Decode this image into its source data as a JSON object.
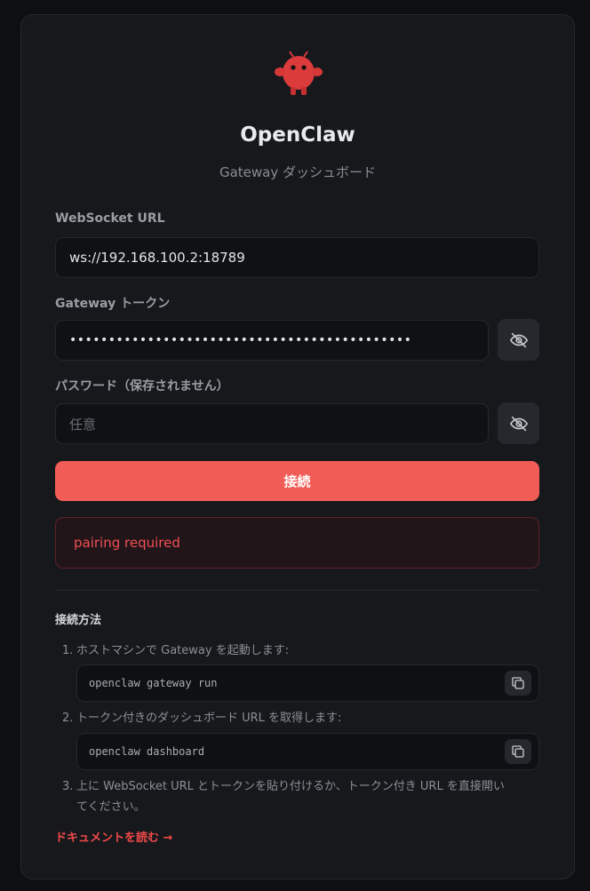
{
  "app": {
    "title": "OpenClaw",
    "subtitle": "Gateway ダッシュボード",
    "logo_icon": "red-claw-mascot-icon"
  },
  "form": {
    "ws_label": "WebSocket URL",
    "ws_value": "ws://192.168.100.2:18789",
    "token_label": "Gateway トークン",
    "token_value": "••••••••••••••••••••••••••••••••••••••••••••",
    "password_label": "パスワード（保存されません）",
    "password_placeholder": "任意",
    "connect_label": "接続"
  },
  "error": {
    "message": "pairing required"
  },
  "instructions": {
    "title": "接続方法",
    "steps": [
      {
        "num": "1.",
        "text": "ホストマシンで Gateway を起動します:",
        "code": "openclaw gateway run"
      },
      {
        "num": "2.",
        "text": "トークン付きのダッシュボード URL を取得します:",
        "code": "openclaw dashboard"
      },
      {
        "num": "3.",
        "text": "上に WebSocket URL とトークンを貼り付けるか、トークン付き URL を直接開い",
        "text_cont": "てください。"
      }
    ],
    "docs_link": "ドキュメントを読む →"
  },
  "colors": {
    "accent": "#f25c57",
    "error_text": "#ef4f52",
    "background": "#0e0f12",
    "card": "#17181c"
  }
}
